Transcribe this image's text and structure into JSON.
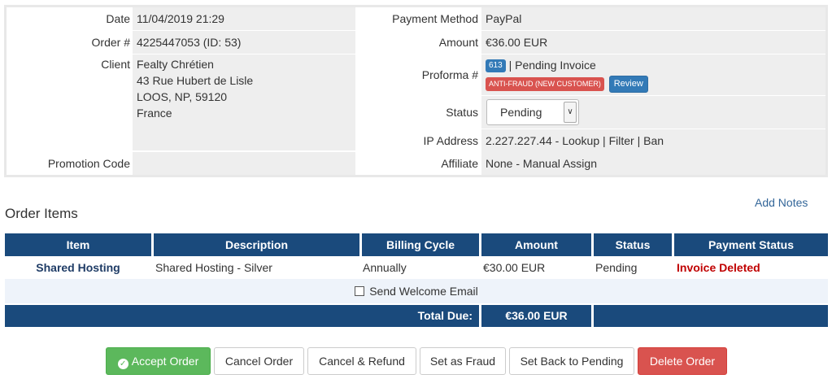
{
  "details": {
    "date": {
      "label": "Date",
      "value": "11/04/2019 21:29"
    },
    "order_no": {
      "label": "Order #",
      "value": "4225447053 (ID: 53)"
    },
    "client": {
      "label": "Client",
      "lines": [
        "Fealty Chrétien",
        "43 Rue Hubert de Lisle",
        "LOOS, NP, 59120",
        "France"
      ]
    },
    "promotion_code": {
      "label": "Promotion Code",
      "value": ""
    },
    "payment_method": {
      "label": "Payment Method",
      "value": "PayPal"
    },
    "amount": {
      "label": "Amount",
      "value": "€36.00 EUR"
    },
    "proforma": {
      "label": "Proforma #",
      "invoice_id": "613",
      "separator": " | ",
      "invoice_text": "Pending Invoice",
      "fraud_badge": "ANTI-FRAUD (NEW CUSTOMER)",
      "review_label": "Review"
    },
    "status": {
      "label": "Status",
      "selected": "Pending"
    },
    "ip_address": {
      "label": "IP Address",
      "ip": "2.227.227.44",
      "dash": " - ",
      "lookup": "Lookup",
      "sep1": " | ",
      "filter": "Filter",
      "sep2": " | ",
      "ban": "Ban"
    },
    "affiliate": {
      "label": "Affiliate",
      "none": "None",
      "dash": " - ",
      "assign": "Manual Assign"
    }
  },
  "add_notes": "Add Notes",
  "order_items": {
    "title": "Order Items",
    "columns": [
      "Item",
      "Description",
      "Billing Cycle",
      "Amount",
      "Status",
      "Payment Status"
    ],
    "rows": [
      {
        "item": "Shared Hosting",
        "description": "Shared Hosting - Silver",
        "billing_cycle": "Annually",
        "amount": "€30.00 EUR",
        "status": "Pending",
        "payment_status": "Invoice Deleted"
      }
    ],
    "welcome_email": "Send Welcome Email",
    "total_label": "Total Due:",
    "total_value": "€36.00 EUR"
  },
  "actions": {
    "accept": "Accept Order",
    "cancel": "Cancel Order",
    "cancel_refund": "Cancel & Refund",
    "fraud": "Set as Fraud",
    "pending": "Set Back to Pending",
    "delete": "Delete Order"
  },
  "colors": {
    "header": "#1a4a7c",
    "accept": "#5cb85c",
    "delete": "#d9534f",
    "deleted_text": "#c00000"
  }
}
